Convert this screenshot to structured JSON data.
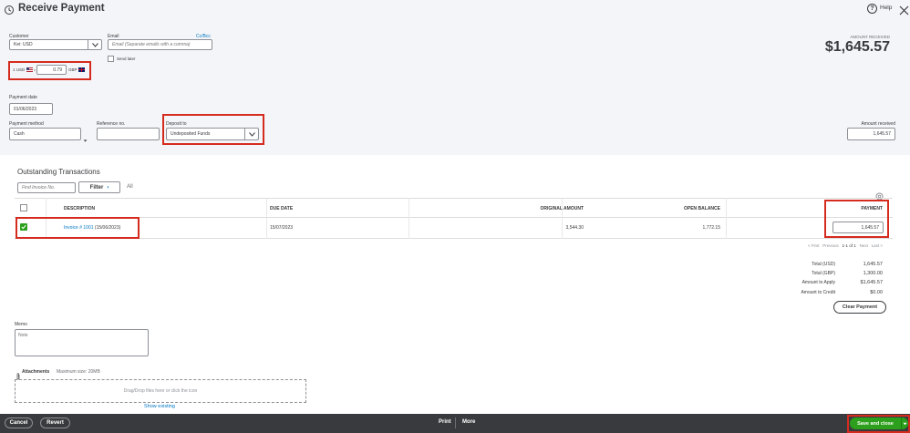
{
  "header": {
    "title": "Receive Payment",
    "help_label": "Help"
  },
  "customer": {
    "label": "Customer",
    "value": "Kei: USD"
  },
  "email": {
    "label": "Email",
    "placeholder": "Email (Separate emails with a comma)",
    "ccbcc": "Cc/Bcc",
    "send_later": "Send later"
  },
  "amount_received_header": {
    "label": "AMOUNT RECEIVED",
    "value": "$1,645.57"
  },
  "exchange": {
    "from": "1 USD",
    "rate": "0.79",
    "to": "GBP"
  },
  "payment_date": {
    "label": "Payment date",
    "value": "01/06/2023"
  },
  "payment_method": {
    "label": "Payment method",
    "value": "Cash"
  },
  "reference": {
    "label": "Reference no.",
    "value": ""
  },
  "deposit_to": {
    "label": "Deposit to",
    "value": "Undeposited Funds"
  },
  "amount_received": {
    "label": "Amount received",
    "value": "1,645.57"
  },
  "outstanding": {
    "title": "Outstanding Transactions",
    "find_placeholder": "Find Invoice No.",
    "filter_label": "Filter",
    "all_label": "All",
    "columns": {
      "description": "DESCRIPTION",
      "due_date": "DUE DATE",
      "original_amount": "ORIGINAL AMOUNT",
      "open_balance": "OPEN BALANCE",
      "payment": "PAYMENT"
    },
    "rows": [
      {
        "invoice_link": "Invoice # 1001",
        "invoice_date": "(15/06/2023)",
        "due_date": "15/07/2023",
        "original_amount": "3,544.30",
        "open_balance": "1,772.15",
        "payment": "1,645.57"
      }
    ],
    "pagination": {
      "first": "< First",
      "previous": "Previous",
      "range": "1-1 of 1",
      "next": "Next",
      "last": "Last >"
    }
  },
  "summary": [
    {
      "label": "Total (USD)",
      "value": "1,645.57"
    },
    {
      "label": "Total (GBP)",
      "value": "1,300.00"
    },
    {
      "label": "Amount to Apply",
      "value": "$1,645.57"
    },
    {
      "label": "Amount to Credit",
      "value": "$0.00"
    }
  ],
  "clear_payment": "Clear Payment",
  "memo": {
    "label": "Memo",
    "placeholder": "Note"
  },
  "attachments": {
    "label": "Attachments",
    "max_size": "Maximum size: 20MB",
    "dropzone": "Drag/Drop files here or click the icon",
    "show_existing": "Show existing"
  },
  "footer": {
    "cancel": "Cancel",
    "revert": "Revert",
    "print": "Print",
    "more": "More",
    "save_close": "Save and close"
  },
  "colors": {
    "highlight": "#d52b1e",
    "primary_green": "#2ca01c",
    "link": "#0077c5",
    "footer_bg": "#393a3d"
  }
}
